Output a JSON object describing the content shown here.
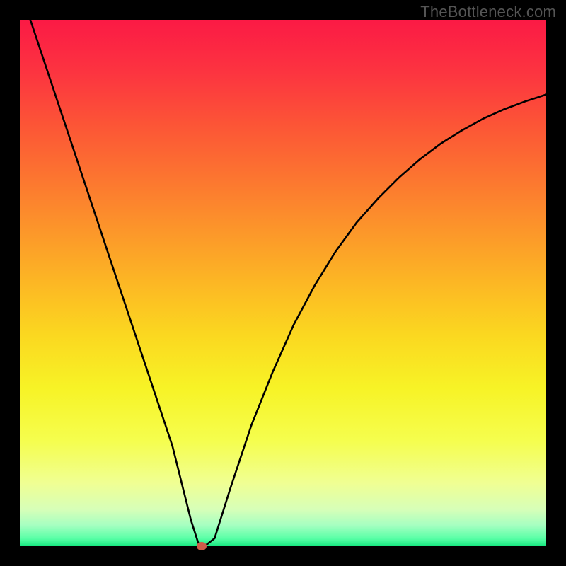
{
  "watermark": "TheBottleneck.com",
  "chart_data": {
    "type": "line",
    "title": "",
    "xlabel": "",
    "ylabel": "",
    "xlim": [
      0,
      100
    ],
    "ylim": [
      0,
      100
    ],
    "grid": false,
    "legend": false,
    "marker": {
      "x": 34.5,
      "y": 0
    },
    "curve": {
      "x": [
        2,
        5,
        8,
        11,
        14,
        17,
        20,
        23,
        26,
        29,
        31,
        32.5,
        34,
        35.5,
        37,
        40,
        44,
        48,
        52,
        56,
        60,
        64,
        68,
        72,
        76,
        80,
        84,
        88,
        92,
        96,
        100
      ],
      "y": [
        100,
        91,
        82,
        73,
        64,
        55,
        46,
        37,
        28,
        19,
        11,
        5,
        0.3,
        0.3,
        1.5,
        11,
        23,
        33,
        42,
        49.5,
        56,
        61.5,
        66,
        70,
        73.5,
        76.5,
        79,
        81.2,
        83,
        84.5,
        85.8
      ]
    },
    "gradient_stops": [
      {
        "pos": 0.0,
        "color": "#fb1a45"
      },
      {
        "pos": 0.1,
        "color": "#fc3440"
      },
      {
        "pos": 0.2,
        "color": "#fc5536"
      },
      {
        "pos": 0.3,
        "color": "#fc7530"
      },
      {
        "pos": 0.4,
        "color": "#fc962a"
      },
      {
        "pos": 0.5,
        "color": "#fcb724"
      },
      {
        "pos": 0.6,
        "color": "#fbd820"
      },
      {
        "pos": 0.7,
        "color": "#f7f326"
      },
      {
        "pos": 0.8,
        "color": "#f5fe4e"
      },
      {
        "pos": 0.88,
        "color": "#f0ff93"
      },
      {
        "pos": 0.93,
        "color": "#d7ffb8"
      },
      {
        "pos": 0.96,
        "color": "#a6ffc1"
      },
      {
        "pos": 0.985,
        "color": "#5affa7"
      },
      {
        "pos": 1.0,
        "color": "#17e880"
      }
    ]
  }
}
